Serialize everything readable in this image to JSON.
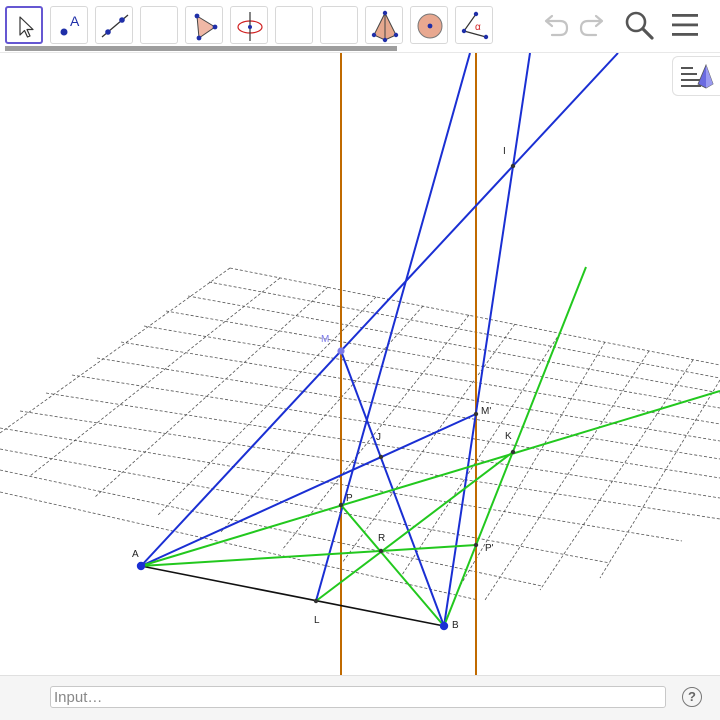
{
  "toolbar": {
    "tools": [
      {
        "name": "move-tool",
        "selected": true
      },
      {
        "name": "point-tool",
        "label": "A"
      },
      {
        "name": "line-tool"
      },
      {
        "name": "empty-tool-1"
      },
      {
        "name": "polygon-tool"
      },
      {
        "name": "plane-tool"
      },
      {
        "name": "empty-tool-2"
      },
      {
        "name": "empty-tool-3"
      },
      {
        "name": "pyramid-tool"
      },
      {
        "name": "sphere-tool"
      },
      {
        "name": "angle-tool",
        "label": "α"
      }
    ],
    "undo_icon": "undo-icon",
    "redo_icon": "redo-icon",
    "search_icon": "search-icon",
    "menu_icon": "menu-icon",
    "accent": "#6557d2"
  },
  "graphics": {
    "colors": {
      "blue_lines": "#1a2fd3",
      "green_lines": "#22c81e",
      "orange_lines": "#c06a00",
      "segment_AB": "#111111",
      "grid": "#555555",
      "point_M": "#7a78e8"
    },
    "points": {
      "A": "A",
      "B": "B",
      "M": "M",
      "M_prime": "M'",
      "I": "I",
      "J": "J",
      "K": "K",
      "L": "L",
      "P": "P",
      "P_prime": "P'",
      "R": "R"
    }
  },
  "style_bar_toggle": "style-bar-toggle-icon",
  "input_bar": {
    "placeholder": "Input…",
    "help": "?"
  }
}
